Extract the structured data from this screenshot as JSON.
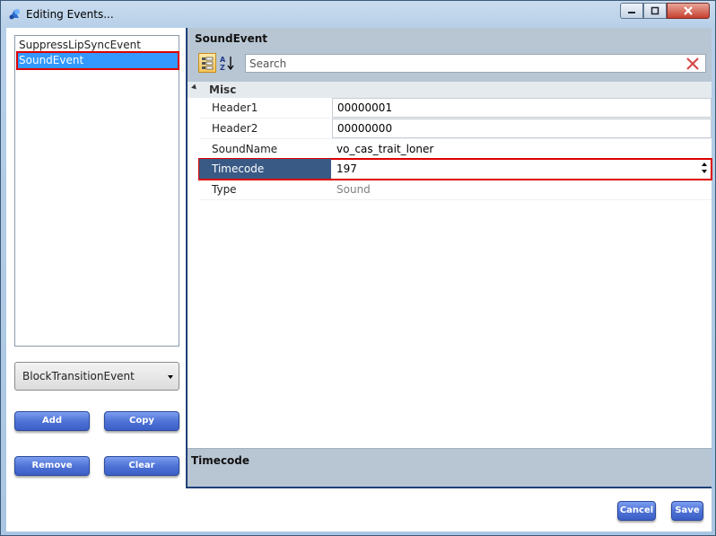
{
  "window": {
    "title": "Editing Events...",
    "controls": {
      "minimize": "—",
      "maximize": "☐",
      "close": "✕"
    }
  },
  "events": {
    "items": [
      {
        "label": "SuppressLipSyncEvent",
        "selected": false
      },
      {
        "label": "SoundEvent",
        "selected": true
      }
    ],
    "type_selector": {
      "value": "BlockTransitionEvent"
    },
    "buttons": {
      "add": "Add",
      "copy": "Copy",
      "remove": "Remove",
      "clear": "Clear"
    }
  },
  "property_grid": {
    "title": "SoundEvent",
    "search": {
      "placeholder": "Search",
      "value": ""
    },
    "category": {
      "name": "Misc"
    },
    "properties": [
      {
        "name": "Header1",
        "value": "00000001",
        "editable": true
      },
      {
        "name": "Header2",
        "value": "00000000",
        "editable": true
      },
      {
        "name": "SoundName",
        "value": "vo_cas_trait_loner",
        "editable": false
      },
      {
        "name": "Timecode",
        "value": "197",
        "editable": true,
        "selected": true
      },
      {
        "name": "Type",
        "value": "Sound",
        "editable": false
      }
    ],
    "description": {
      "title": "Timecode"
    }
  },
  "footer": {
    "cancel": "Cancel",
    "save": "Save"
  },
  "colors": {
    "accent": "#3399ff",
    "highlight": "#dd0000",
    "button": "#4f73d6",
    "selected_prop": "#3a5a86"
  },
  "icons": {
    "app": "events-app-icon",
    "categorized": "categorized-sort-icon",
    "alphabetical": "alphabetical-sort-icon",
    "clear_search": "clear-x-icon"
  }
}
